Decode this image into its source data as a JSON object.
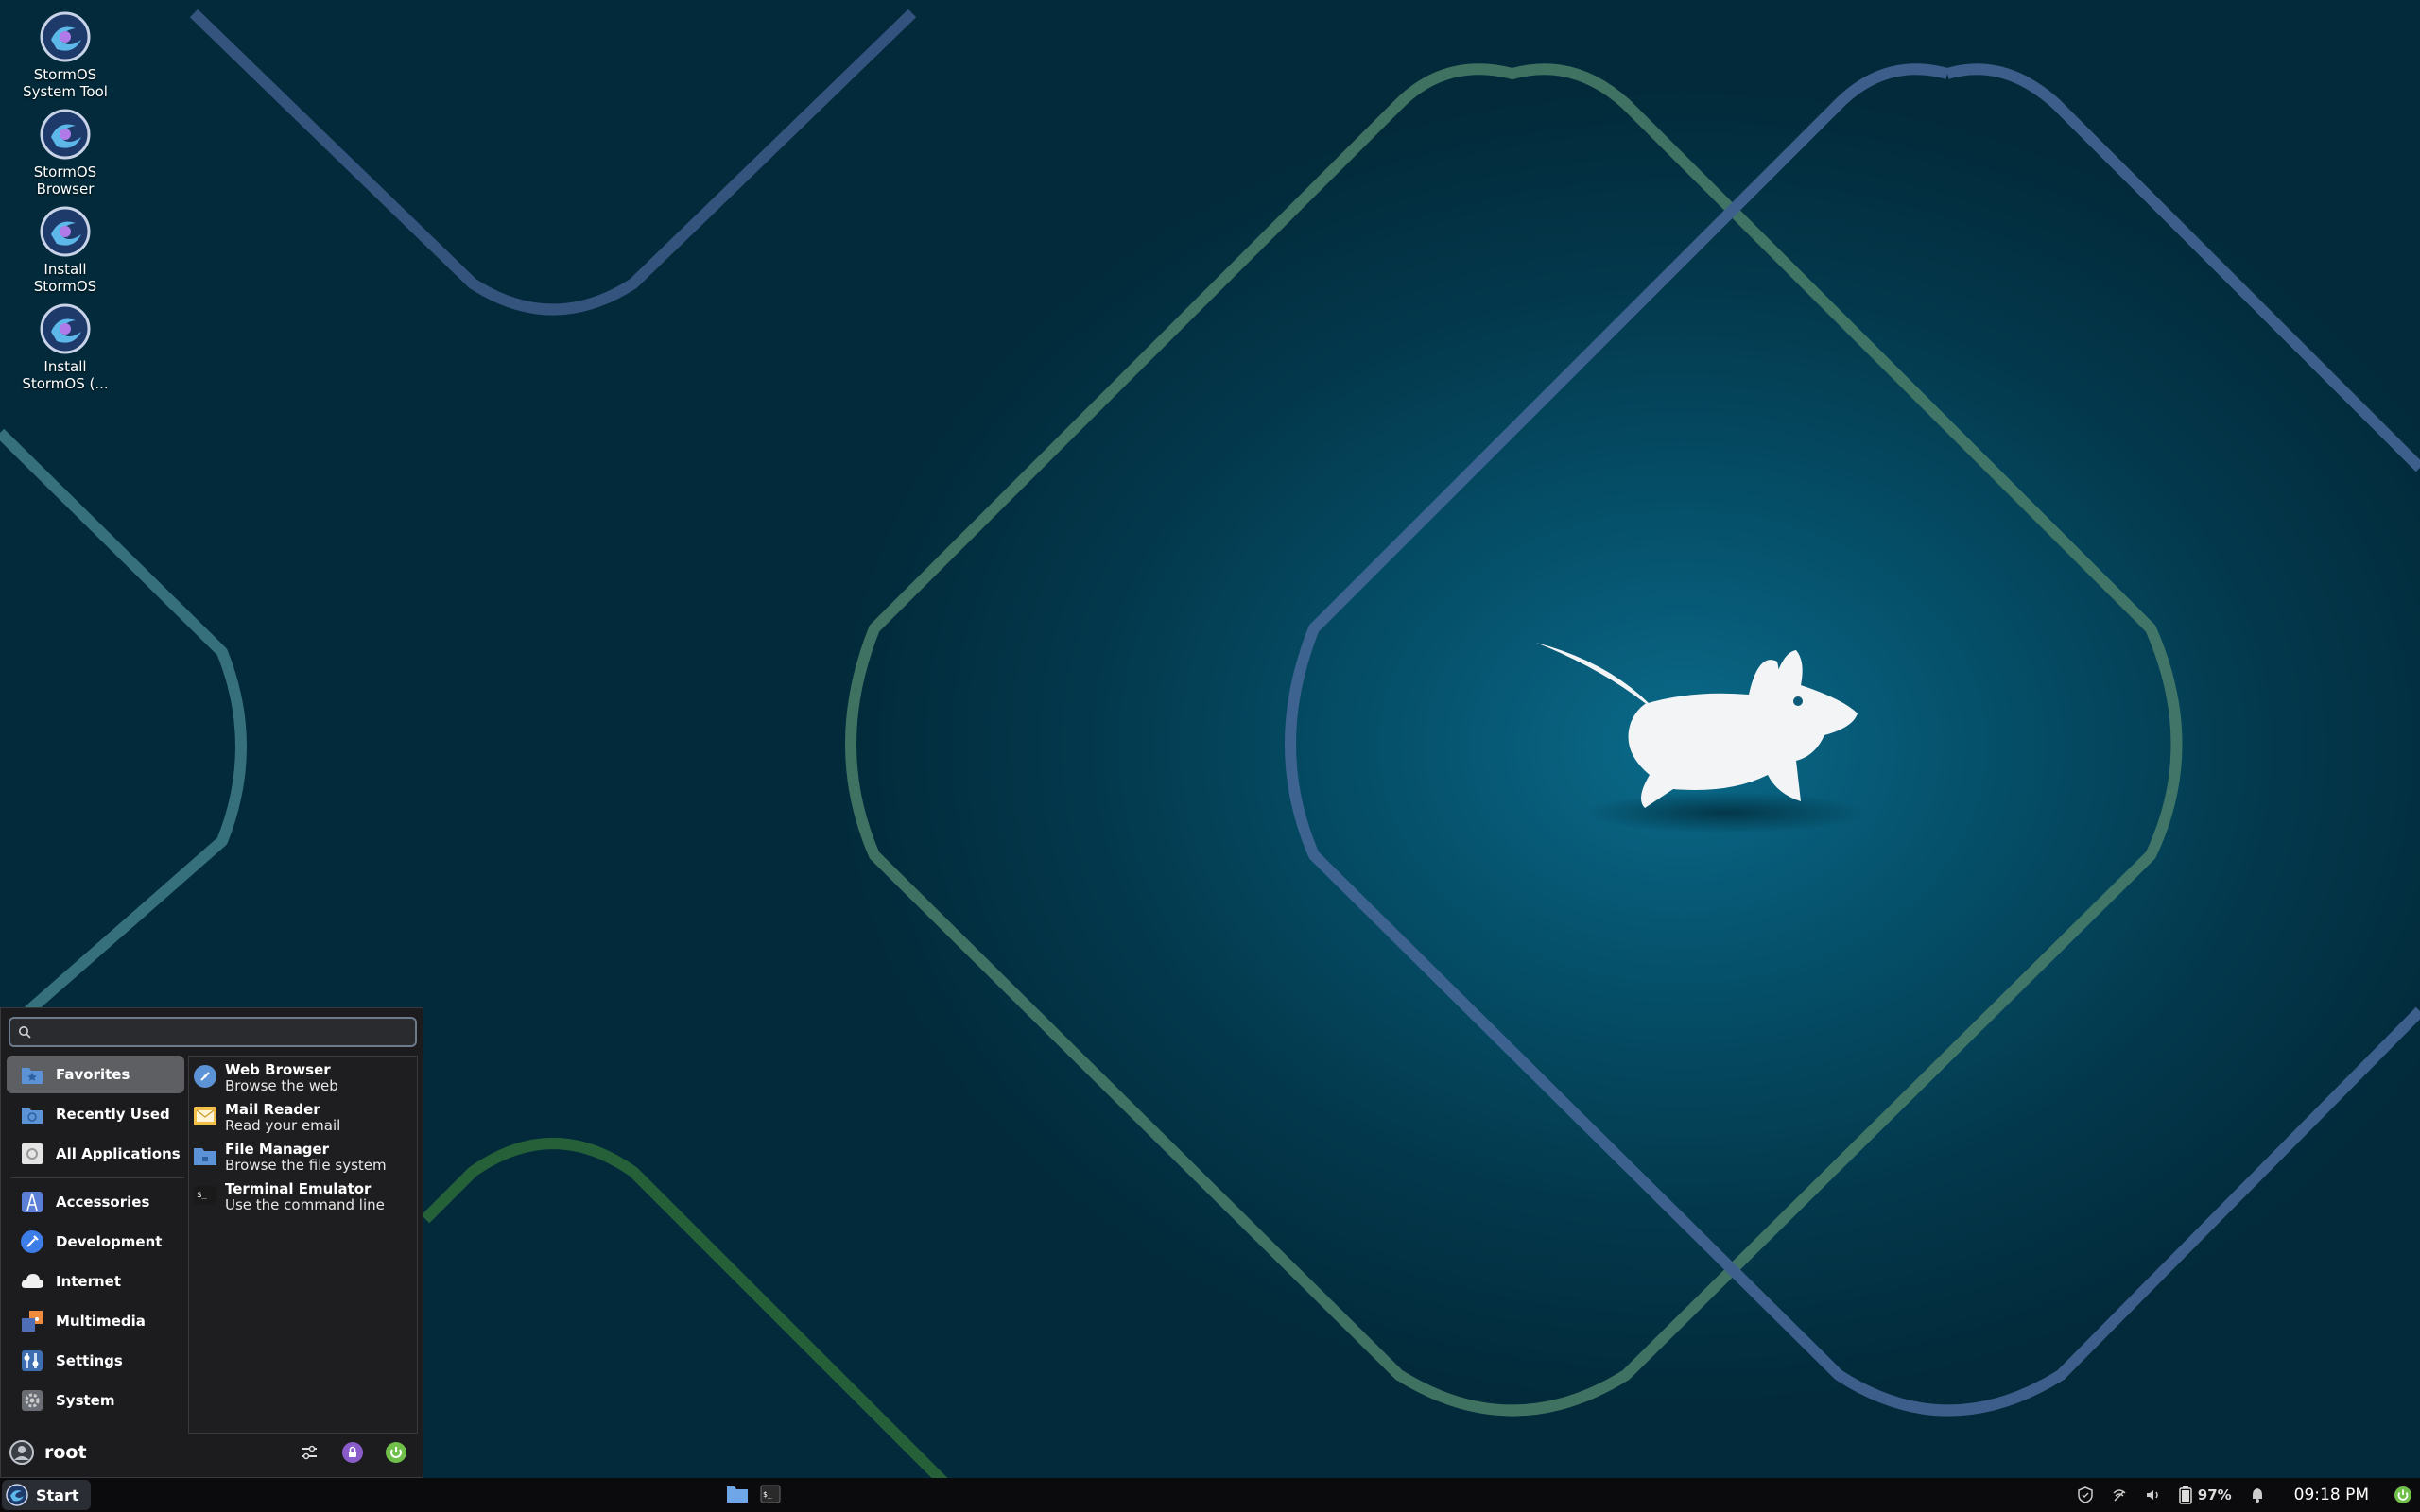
{
  "desktop": {
    "icons": [
      {
        "label": "StormOS System Tool",
        "icon": "stormos-logo-icon"
      },
      {
        "label": "StormOS Browser",
        "icon": "stormos-logo-icon"
      },
      {
        "label": "Install StormOS",
        "icon": "stormos-logo-icon"
      },
      {
        "label": "Install StormOS (...",
        "icon": "stormos-logo-icon"
      }
    ]
  },
  "menu": {
    "search": {
      "value": "",
      "placeholder": ""
    },
    "categories": [
      {
        "label": "Favorites",
        "icon": "favorites-folder-icon",
        "active": true
      },
      {
        "label": "Recently Used",
        "icon": "recent-folder-icon"
      },
      {
        "label": "All Applications",
        "icon": "all-apps-icon"
      },
      {
        "label": "Accessories",
        "icon": "accessories-icon"
      },
      {
        "label": "Development",
        "icon": "development-icon"
      },
      {
        "label": "Internet",
        "icon": "internet-cloud-icon"
      },
      {
        "label": "Multimedia",
        "icon": "multimedia-icon"
      },
      {
        "label": "Settings",
        "icon": "settings-icon"
      },
      {
        "label": "System",
        "icon": "system-gear-icon"
      }
    ],
    "apps": [
      {
        "name": "Web Browser",
        "desc": "Browse the web",
        "icon": "web-browser-icon"
      },
      {
        "name": "Mail Reader",
        "desc": "Read your email",
        "icon": "mail-icon"
      },
      {
        "name": "File Manager",
        "desc": "Browse the file system",
        "icon": "file-manager-icon"
      },
      {
        "name": "Terminal Emulator",
        "desc": "Use the command line",
        "icon": "terminal-icon"
      }
    ],
    "user": {
      "name": "root",
      "icon": "user-avatar-icon"
    },
    "actions": [
      "settings-sliders-icon",
      "lock-icon",
      "logout-icon"
    ]
  },
  "taskbar": {
    "start_label": "Start",
    "tasks": [
      "file-manager-icon",
      "terminal-icon"
    ],
    "tray": {
      "battery_percent": "97%",
      "clock": "09:18 PM",
      "icons": [
        "shield-icon",
        "network-icon",
        "volume-icon",
        "battery-icon",
        "notification-bell-icon",
        "power-status-icon"
      ]
    }
  },
  "colors": {
    "accent_green": "#6fbf4a",
    "menu_bg": "#1c1c1e",
    "taskbar_bg": "#0b0b0d",
    "active_category": "#5e5f63"
  }
}
